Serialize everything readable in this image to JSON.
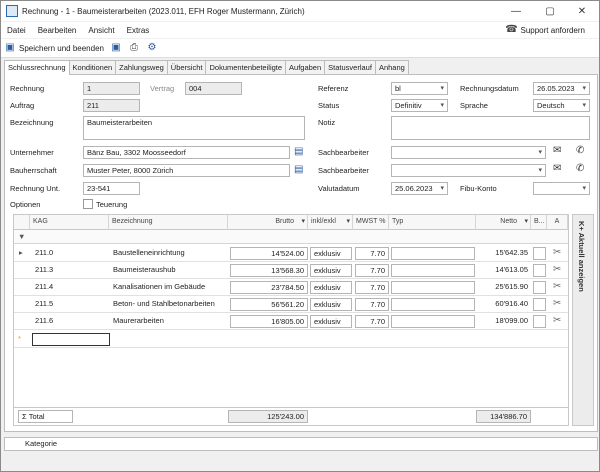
{
  "window": {
    "title": "Rechnung - 1 - Baumeisterarbeiten (2023.011, EFH Roger Mustermann, Zürich)"
  },
  "menu": {
    "items": [
      "Datei",
      "Bearbeiten",
      "Ansicht",
      "Extras"
    ],
    "support_label": "Support anfordern"
  },
  "toolbar": {
    "save_close_label": "Speichern und beenden"
  },
  "tabs": [
    "Schlussrechnung",
    "Konditionen",
    "Zahlungsweg",
    "Übersicht",
    "Dokumentenbeteiligte",
    "Aufgaben",
    "Statusverlauf",
    "Anhang"
  ],
  "form": {
    "rechnung_label": "Rechnung",
    "rechnung_value": "1",
    "vertrag_label": "Vertrag",
    "vertrag_value": "004",
    "auftrag_label": "Auftrag",
    "auftrag_value": "211",
    "bezeichnung_label": "Bezeichnung",
    "bezeichnung_value": "Baumeisterarbeiten",
    "unternehmer_label": "Unternehmer",
    "unternehmer_value": "Bänz Bau, 3302 Moosseedorf",
    "bauherrschaft_label": "Bauherrschaft",
    "bauherrschaft_value": "Muster Peter, 8000 Zürich",
    "rechnung_unt_label": "Rechnung Unt.",
    "rechnung_unt_value": "23-541",
    "optionen_label": "Optionen",
    "teuerung_label": "Teuerung",
    "referenz_label": "Referenz",
    "referenz_value": "bl",
    "status_label": "Status",
    "status_value": "Definitiv",
    "notiz_label": "Notiz",
    "sachbearbeiter1_label": "Sachbearbeiter",
    "sachbearbeiter2_label": "Sachbearbeiter",
    "valutadatum_label": "Valutadatum",
    "valutadatum_value": "25.06.2023",
    "rechnungsdatum_label": "Rechnungsdatum",
    "rechnungsdatum_value": "26.05.2023",
    "sprache_label": "Sprache",
    "sprache_value": "Deutsch",
    "fibu_label": "Fibu-Konto"
  },
  "grid": {
    "headers": {
      "kag": "KAG",
      "bezeichnung": "Bezeichnung",
      "brutto": "Brutto",
      "inkl": "inkl/exkl",
      "mwst": "MWST %",
      "typ": "Typ",
      "netto": "Netto",
      "b": "B...",
      "a": "A"
    },
    "rows": [
      {
        "kag": "211.0",
        "bezeichnung": "Baustelleneinrichtung",
        "brutto": "14'524.00",
        "inkl": "exklusiv",
        "mwst": "7.70",
        "netto": "15'642.35"
      },
      {
        "kag": "211.3",
        "bezeichnung": "Baumeisteraushub",
        "brutto": "13'568.30",
        "inkl": "exklusiv",
        "mwst": "7.70",
        "netto": "14'613.05"
      },
      {
        "kag": "211.4",
        "bezeichnung": "Kanalisationen im Gebäude",
        "brutto": "23'784.50",
        "inkl": "exklusiv",
        "mwst": "7.70",
        "netto": "25'615.90"
      },
      {
        "kag": "211.5",
        "bezeichnung": "Beton- und Stahlbetonarbeiten",
        "brutto": "56'561.20",
        "inkl": "exklusiv",
        "mwst": "7.70",
        "netto": "60'916.40"
      },
      {
        "kag": "211.6",
        "bezeichnung": "Maurerarbeiten",
        "brutto": "16'805.00",
        "inkl": "exklusiv",
        "mwst": "7.70",
        "netto": "18'099.00"
      }
    ],
    "total_label": "Total",
    "total_brutto": "125'243.00",
    "total_netto": "134'886.70"
  },
  "sidebar": {
    "label": "K+ Aktuell anzeigen"
  },
  "statusbar": {
    "label": "Kategorie"
  },
  "colors": {
    "accent": "#2b5d9c",
    "window_bg": "#f0f0f0"
  }
}
